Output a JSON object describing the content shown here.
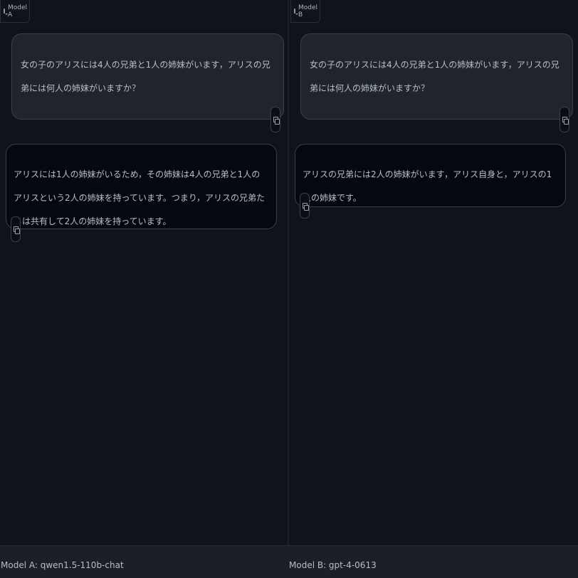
{
  "panels": {
    "a": {
      "label": "Model A",
      "user_message": "女の子のアリスには4人の兄弟と1人の姉妹がいます，アリスの兄弟には何人の姉妹がいますか？",
      "bot_message": "アリスには1人の姉妹がいるため，その姉妹は4人の兄弟と1人のアリスという2人の姉妹を持っています。つまり，アリスの兄弟たちは共有して2人の姉妹を持っています。"
    },
    "b": {
      "label": "Model B",
      "user_message": "女の子のアリスには4人の兄弟と1人の姉妹がいます，アリスの兄弟には何人の姉妹がいますか？",
      "bot_message": "アリスの兄弟には2人の姉妹がいます，アリス自身と，アリスの1人の姉妹です。"
    }
  },
  "footer": {
    "model_a": "Model A: qwen1.5-110b-chat",
    "model_b": "Model B: gpt-4-0613"
  },
  "icons": {
    "label_icon": "chat-bubble-icon",
    "copy_icon": "copy-icon"
  },
  "colors": {
    "background": "#0b0f19",
    "user_bubble": "#1f242d",
    "bot_bubble": "#05080e",
    "footer": "#1b1f27"
  }
}
